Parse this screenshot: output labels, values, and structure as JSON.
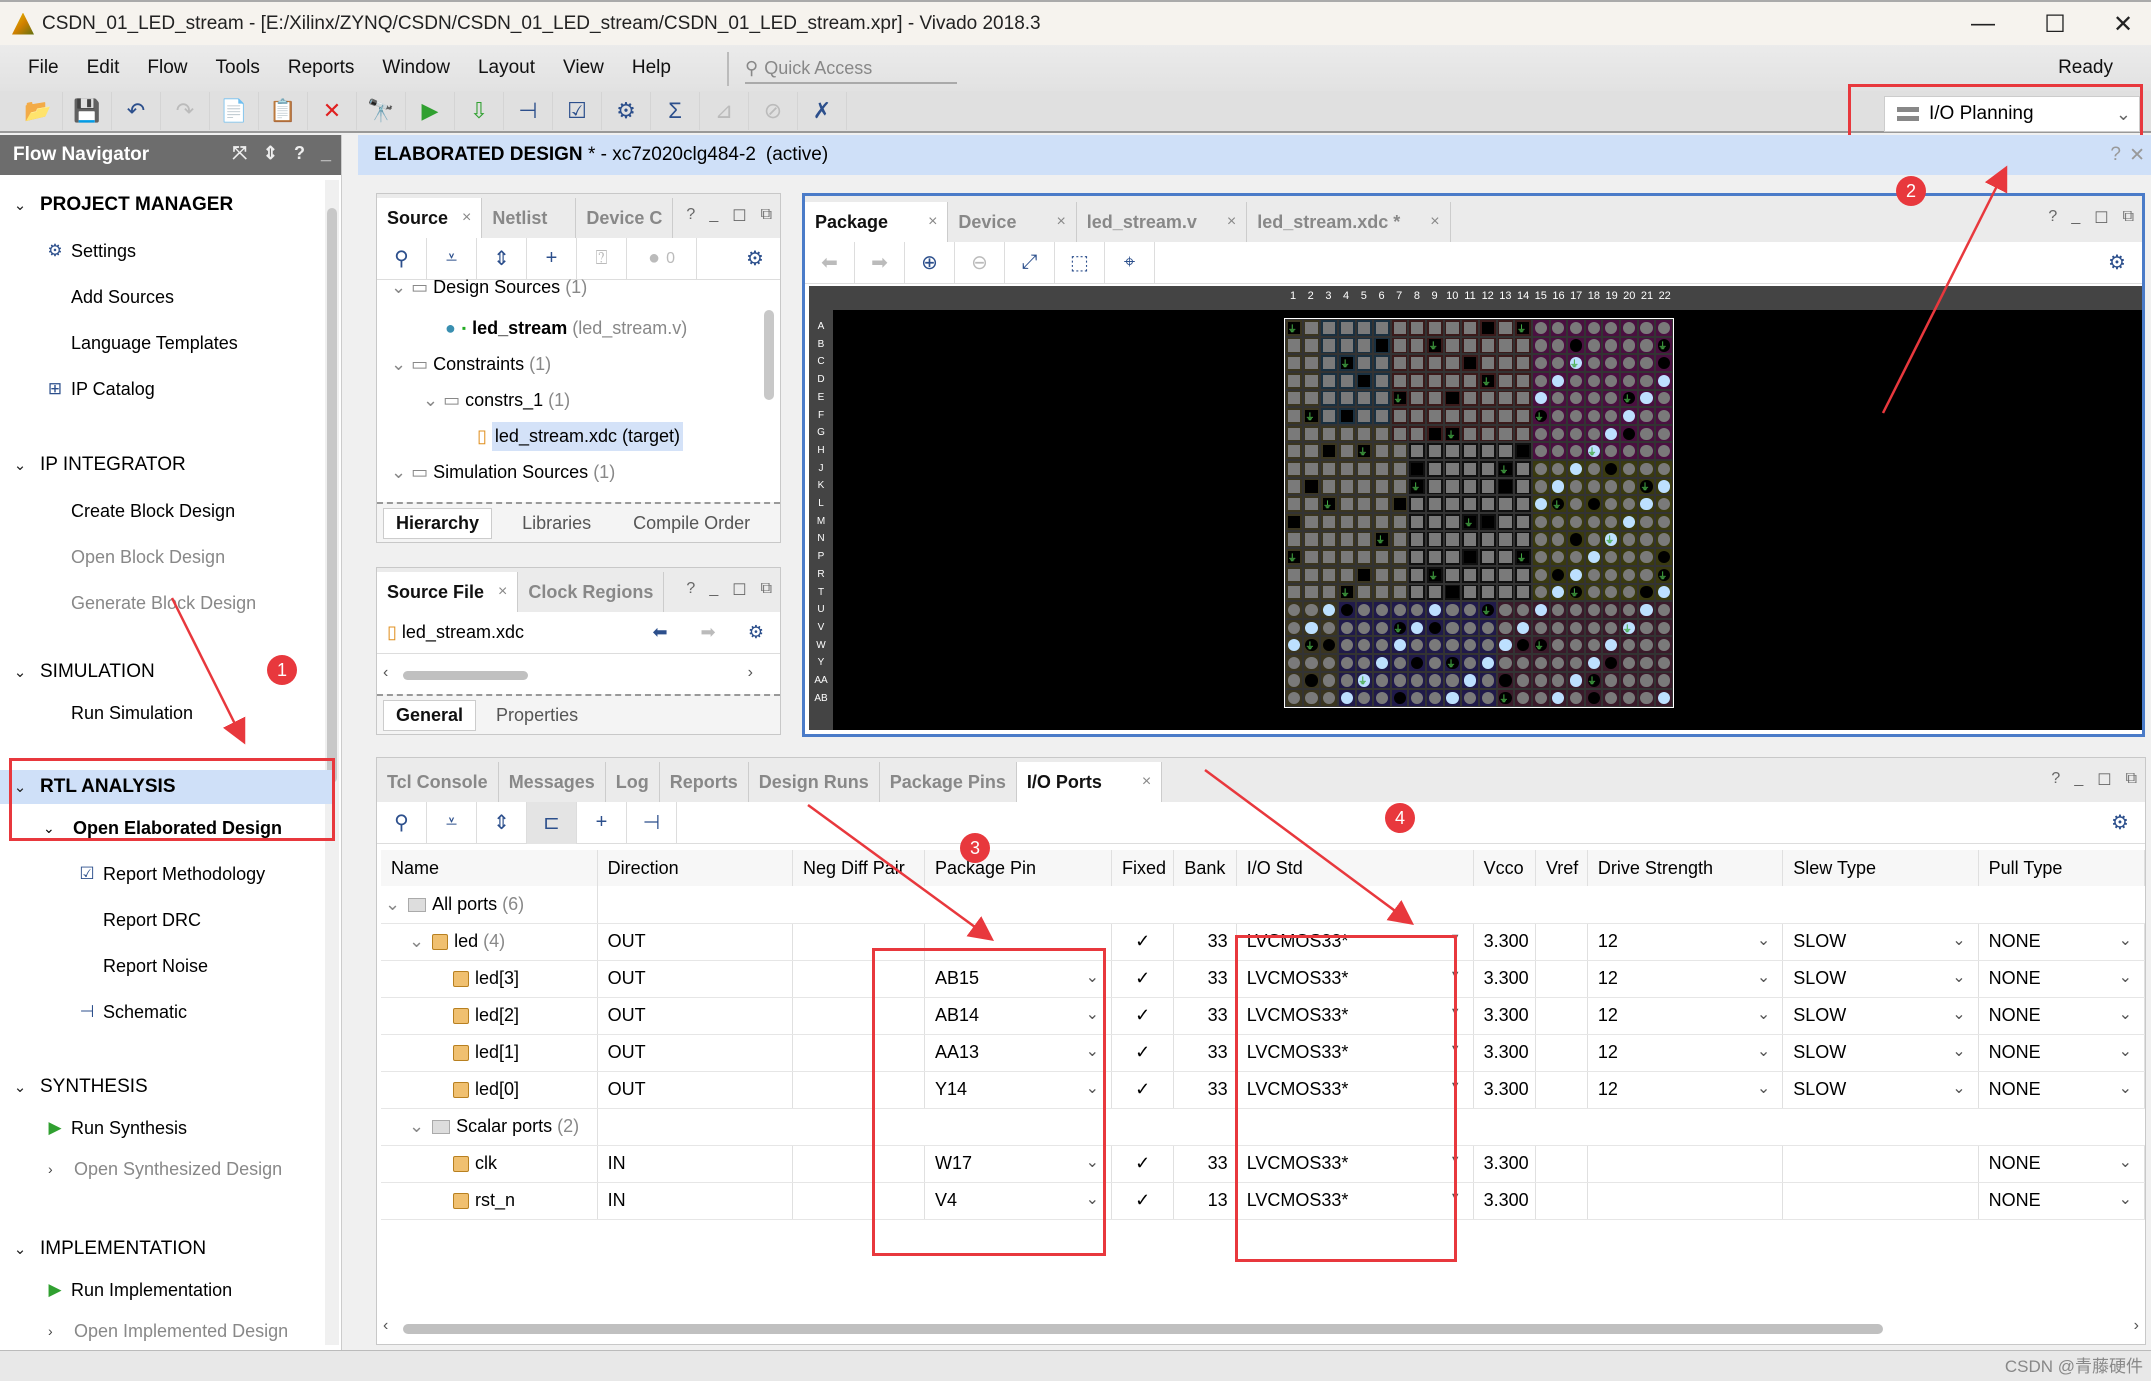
{
  "window": {
    "title": "CSDN_01_LED_stream - [E:/Xilinx/ZYNQ/CSDN/CSDN_01_LED_stream/CSDN_01_LED_stream.xpr] - Vivado 2018.3",
    "minimize": "—",
    "maximize": "☐",
    "close": "✕"
  },
  "menu": [
    "File",
    "Edit",
    "Flow",
    "Tools",
    "Reports",
    "Window",
    "Layout",
    "View",
    "Help"
  ],
  "quick_access": {
    "placeholder": "Quick Access",
    "icon": "search-icon"
  },
  "status": "Ready",
  "toolbar": [
    {
      "name": "open-project-icon",
      "glyph": "📂",
      "enabled": true
    },
    {
      "name": "save-icon",
      "glyph": "💾",
      "enabled": true
    },
    {
      "name": "undo-icon",
      "glyph": "↶",
      "enabled": true
    },
    {
      "name": "redo-icon",
      "glyph": "↷",
      "enabled": false
    },
    {
      "name": "copy-icon",
      "glyph": "📄",
      "enabled": true
    },
    {
      "name": "paste-icon",
      "glyph": "📋",
      "enabled": false
    },
    {
      "name": "delete-icon",
      "glyph": "✕",
      "enabled": true
    },
    {
      "name": "find-icon",
      "glyph": "🔭",
      "enabled": true
    },
    {
      "name": "run-icon",
      "glyph": "▶",
      "enabled": true
    },
    {
      "name": "program-device-icon",
      "glyph": "⇩",
      "enabled": true
    },
    {
      "name": "schematic-icon",
      "glyph": "⊣",
      "enabled": true
    },
    {
      "name": "report-icon",
      "glyph": "☑",
      "enabled": true
    },
    {
      "name": "settings-icon",
      "glyph": "⚙",
      "enabled": true
    },
    {
      "name": "sum-icon",
      "glyph": "Σ",
      "enabled": true
    },
    {
      "name": "unplace-icon",
      "glyph": "⊿",
      "enabled": false
    },
    {
      "name": "route-icon",
      "glyph": "⊘",
      "enabled": false
    },
    {
      "name": "auto-place-icon",
      "glyph": "✗",
      "enabled": true
    }
  ],
  "layout_selector": {
    "value": "I/O Planning"
  },
  "flow_navigator": {
    "title": "Flow Navigator",
    "sections": [
      {
        "label": "PROJECT MANAGER",
        "items": [
          {
            "label": "Settings",
            "icon": "gear-icon",
            "enabled": true
          },
          {
            "label": "Add Sources",
            "enabled": true
          },
          {
            "label": "Language Templates",
            "enabled": true
          },
          {
            "label": "IP Catalog",
            "icon": "ip-catalog-icon",
            "enabled": true
          }
        ]
      },
      {
        "label": "IP INTEGRATOR",
        "items": [
          {
            "label": "Create Block Design",
            "enabled": true
          },
          {
            "label": "Open Block Design",
            "enabled": false
          },
          {
            "label": "Generate Block Design",
            "enabled": false
          }
        ]
      },
      {
        "label": "SIMULATION",
        "items": [
          {
            "label": "Run Simulation",
            "enabled": true
          }
        ]
      },
      {
        "label": "RTL ANALYSIS",
        "items": [
          {
            "label": "Open Elaborated Design",
            "enabled": true
          },
          {
            "label": "Report Methodology",
            "icon": "clipboard-check-icon",
            "enabled": true
          },
          {
            "label": "Report DRC",
            "enabled": true
          },
          {
            "label": "Report Noise",
            "enabled": true
          },
          {
            "label": "Schematic",
            "icon": "schematic-icon",
            "enabled": true
          }
        ]
      },
      {
        "label": "SYNTHESIS",
        "items": [
          {
            "label": "Run Synthesis",
            "icon": "run-icon",
            "enabled": true
          },
          {
            "label": "Open Synthesized Design",
            "enabled": false
          }
        ]
      },
      {
        "label": "IMPLEMENTATION",
        "items": [
          {
            "label": "Run Implementation",
            "icon": "run-icon",
            "enabled": true
          },
          {
            "label": "Open Implemented Design",
            "enabled": false
          }
        ]
      }
    ]
  },
  "design_bar": {
    "title": "ELABORATED DESIGN",
    "modified": " * - ",
    "part": "xc7z020clg484-2",
    "state": "(active)"
  },
  "sources_panel": {
    "tabs": [
      "Source",
      "Netlist",
      "Device C"
    ],
    "error_count": "0",
    "tree": [
      {
        "label": "Design Sources",
        "count": "(1)"
      },
      {
        "label": "led_stream",
        "suffix": "(led_stream.v)"
      },
      {
        "label": "Constraints",
        "count": "(1)"
      },
      {
        "label": "constrs_1",
        "count": "(1)"
      },
      {
        "label": "led_stream.xdc (target)"
      },
      {
        "label": "Simulation Sources",
        "count": "(1)"
      }
    ],
    "subtabs": [
      "Hierarchy",
      "Libraries",
      "Compile Order"
    ]
  },
  "source_file_panel": {
    "tabs": [
      "Source File",
      "Clock Regions"
    ],
    "file": "led_stream.xdc",
    "subtabs": [
      "General",
      "Properties"
    ]
  },
  "package_panel": {
    "tabs": [
      "Package",
      "Device",
      "led_stream.v",
      "led_stream.xdc *"
    ],
    "columns": [
      "1",
      "2",
      "3",
      "4",
      "5",
      "6",
      "7",
      "8",
      "9",
      "10",
      "11",
      "12",
      "13",
      "14",
      "15",
      "16",
      "17",
      "18",
      "19",
      "20",
      "21",
      "22"
    ],
    "rows": [
      "A",
      "B",
      "C",
      "D",
      "E",
      "F",
      "G",
      "H",
      "J",
      "K",
      "L",
      "M",
      "N",
      "P",
      "R",
      "T",
      "U",
      "V",
      "W",
      "Y",
      "AA",
      "AB"
    ]
  },
  "bottom_panel": {
    "tabs": [
      "Tcl Console",
      "Messages",
      "Log",
      "Reports",
      "Design Runs",
      "Package Pins",
      "I/O Ports"
    ],
    "columns": [
      "Name",
      "Direction",
      "Neg Diff Pair",
      "Package Pin",
      "Fixed",
      "Bank",
      "I/O Std",
      "Vcco",
      "Vref",
      "Drive Strength",
      "Slew Type",
      "Pull Type"
    ],
    "rows": [
      {
        "name": "All ports",
        "count": "(6)",
        "level": 0,
        "group": true
      },
      {
        "name": "led",
        "count": "(4)",
        "level": 1,
        "dir": "OUT",
        "pin": "",
        "fixed": "✓",
        "bank": "33",
        "iostd": "LVCMOS33*",
        "vcco": "3.300",
        "drive": "12",
        "slew": "SLOW",
        "pull": "NONE"
      },
      {
        "name": "led[3]",
        "level": 2,
        "dir": "OUT",
        "pin": "AB15",
        "fixed": "✓",
        "bank": "33",
        "iostd": "LVCMOS33*",
        "vcco": "3.300",
        "drive": "12",
        "slew": "SLOW",
        "pull": "NONE"
      },
      {
        "name": "led[2]",
        "level": 2,
        "dir": "OUT",
        "pin": "AB14",
        "fixed": "✓",
        "bank": "33",
        "iostd": "LVCMOS33*",
        "vcco": "3.300",
        "drive": "12",
        "slew": "SLOW",
        "pull": "NONE"
      },
      {
        "name": "led[1]",
        "level": 2,
        "dir": "OUT",
        "pin": "AA13",
        "fixed": "✓",
        "bank": "33",
        "iostd": "LVCMOS33*",
        "vcco": "3.300",
        "drive": "12",
        "slew": "SLOW",
        "pull": "NONE"
      },
      {
        "name": "led[0]",
        "level": 2,
        "dir": "OUT",
        "pin": "Y14",
        "fixed": "✓",
        "bank": "33",
        "iostd": "LVCMOS33*",
        "vcco": "3.300",
        "drive": "12",
        "slew": "SLOW",
        "pull": "NONE"
      },
      {
        "name": "Scalar ports",
        "count": "(2)",
        "level": 1,
        "group": true
      },
      {
        "name": "clk",
        "level": 2,
        "dir": "IN",
        "pin": "W17",
        "fixed": "✓",
        "bank": "33",
        "iostd": "LVCMOS33*",
        "vcco": "3.300",
        "drive": "",
        "slew": "",
        "pull": "NONE"
      },
      {
        "name": "rst_n",
        "level": 2,
        "dir": "IN",
        "pin": "V4",
        "fixed": "✓",
        "bank": "13",
        "iostd": "LVCMOS33*",
        "vcco": "3.300",
        "drive": "",
        "slew": "",
        "pull": "NONE"
      }
    ]
  },
  "annotations": [
    "1",
    "2",
    "3",
    "4"
  ],
  "watermark": "CSDN @青藤硬件",
  "colors": {
    "accent_red": "#e8383d",
    "active_bar": "#cfe0f8",
    "nav_header": "#6d6d6d",
    "package_border": "#4a7bc8"
  }
}
